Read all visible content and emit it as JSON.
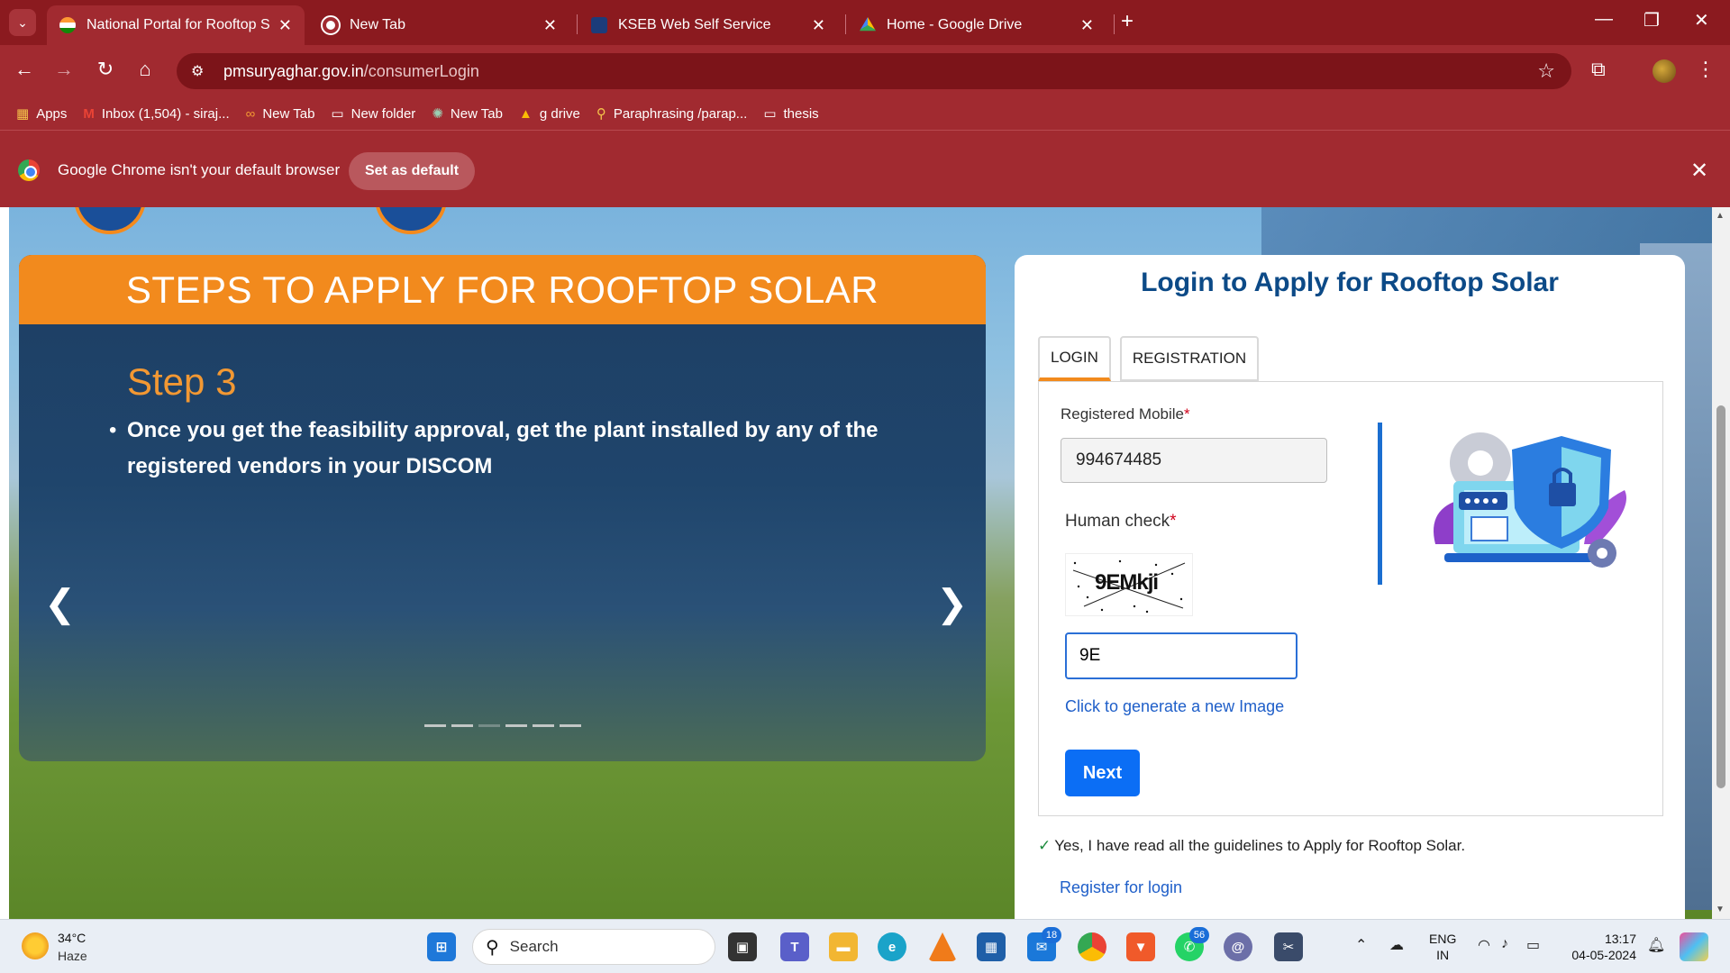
{
  "browser": {
    "tabs": [
      {
        "title": "National Portal for Rooftop Solar",
        "active": true
      },
      {
        "title": "New Tab",
        "active": false
      },
      {
        "title": "KSEB Web Self Service",
        "active": false
      },
      {
        "title": "Home - Google Drive",
        "active": false
      }
    ],
    "url_domain": "pmsuryaghar.gov.in",
    "url_path": "/consumerLogin",
    "bookmarks": [
      {
        "label": "Apps",
        "icon": "apps-grid-icon"
      },
      {
        "label": "Inbox (1,504) - siraj...",
        "icon": "gmail-icon"
      },
      {
        "label": "New Tab",
        "icon": "link-icon"
      },
      {
        "label": "New folder",
        "icon": "folder-icon"
      },
      {
        "label": "New Tab",
        "icon": "chatgpt-icon"
      },
      {
        "label": "g drive",
        "icon": "drive-icon"
      },
      {
        "label": "Paraphrasing /parap...",
        "icon": "search-icon"
      },
      {
        "label": "thesis",
        "icon": "folder-icon"
      }
    ],
    "infobar": {
      "message": "Google Chrome isn't your default browser",
      "button": "Set as default"
    }
  },
  "steps": {
    "header": "STEPS TO APPLY FOR ROOFTOP SOLAR",
    "step_title": "Step 3",
    "step_text": "Once you get the feasibility approval, get the plant installed by any of the registered vendors in your DISCOM",
    "prev": "‹",
    "next": "›",
    "indicator_count": 6,
    "active_indicator": 3
  },
  "login": {
    "title": "Login to Apply for Rooftop Solar",
    "tab_login": "LOGIN",
    "tab_registration": "REGISTRATION",
    "mobile_label": "Registered Mobile",
    "mobile_value": "994674485",
    "human_check_label": "Human check",
    "required_mark": "*",
    "captcha_text": "9EMkji",
    "captcha_input_value": "9E",
    "regen_link": "Click to generate a new Image",
    "next_button": "Next",
    "guidelines": "Yes, I have read all the guidelines to Apply for Rooftop Solar.",
    "register_link": "Register for login"
  },
  "taskbar": {
    "weather_temp": "34°C",
    "weather_cond": "Haze",
    "search_placeholder": "Search",
    "badge_mail": "18",
    "badge_whatsapp": "56",
    "lang_1": "ENG",
    "lang_2": "IN",
    "time": "13:17",
    "date": "04-05-2024"
  },
  "colors": {
    "chrome_frame": "#a12a30",
    "steps_header": "#f28a1d",
    "login_title": "#0c4a87",
    "next_button": "#0b6ef5"
  }
}
